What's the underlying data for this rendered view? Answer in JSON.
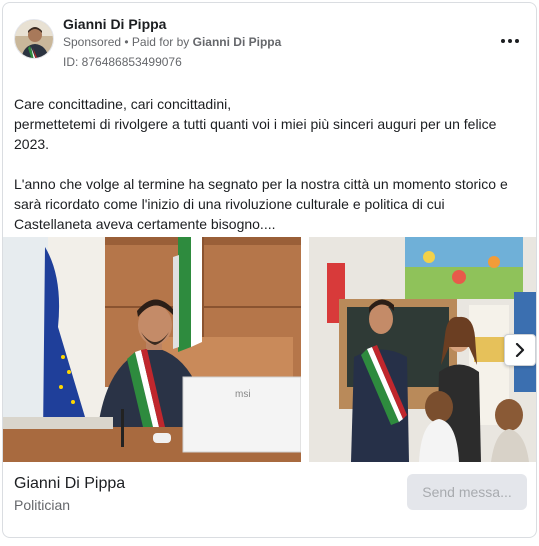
{
  "header": {
    "page_name": "Gianni Di Pippa",
    "sponsored": "Sponsored",
    "paid_for_prefix": " • Paid for by ",
    "paid_for_name": "Gianni Di Pippa",
    "ad_id": "ID: 876486853499076"
  },
  "post": {
    "lines": [
      "Care concittadine, cari concittadini,",
      "permettetemi di rivolgere a tutti quanti voi i miei più sinceri auguri per un felice 2023."
    ],
    "paragraph2": "L'anno che volge al termine ha segnato per la nostra città un momento storico e sarà ricordato come l'inizio di una rivoluzione culturale e politica di cui Castellaneta aveva certamente bisogno...."
  },
  "carousel": {
    "monitor_brand": "msi"
  },
  "footer": {
    "name": "Gianni Di Pippa",
    "category": "Politician",
    "button_label": "Send messa..."
  },
  "icons": [
    "more-icon",
    "chevron-right-icon"
  ],
  "colors": {
    "text_primary": "#1c1e21",
    "text_secondary": "#65676b",
    "button_bg": "#e4e6eb",
    "button_text": "#a8abaf"
  }
}
